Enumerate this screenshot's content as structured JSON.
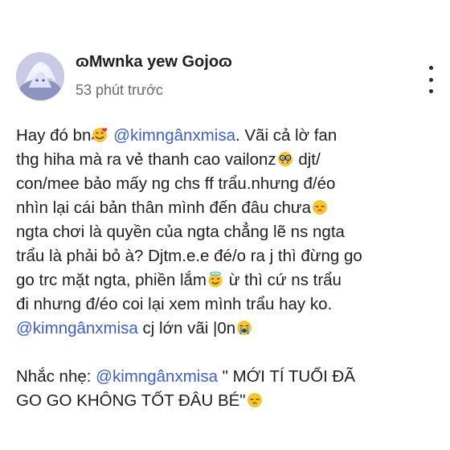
{
  "post": {
    "author": "ɷMwnka yew Gojoɷ",
    "time": "53 phút trước"
  },
  "icons": {
    "more": "more-vertical-icon",
    "avatar": "user-avatar-image"
  },
  "colors": {
    "mention": "#3d5fc7",
    "text": "#1f1f1f",
    "time": "#6b6b6b"
  },
  "content": {
    "l1a": "Hay đó bn",
    "l1b": "@kimngânxmisa",
    "l1c": ". Vãi cả lờ fan",
    "l2a": "thg hiha mà ra vẻ thanh cao vailonz",
    "l2b": " djt/",
    "l3": "con/mee  bảo mấy ng chs ff trẩu.nhưng đ/éo",
    "l4": "nhìn lại cái bản thân mình đến đâu chưa",
    "l5": "ngta chơi là quyền của ngta chẳng lẽ ns ngta",
    "l6": "trẩu là phải bỏ à? Djtm.e.e đé/o ra j thì đừng go",
    "l7a": "go trc mặt ngta, phiền lắm",
    "l7b": " ừ thì cứ ns trẩu",
    "l8": "đi nhưng đ/éo coi lại xem mình trẩu hay ko.",
    "l9a": "@kimngânxmisa",
    "l9b": " cj lớn vãi |0n",
    "l10a": "Nhắc nhẹ: ",
    "l10b": "@kimngânxmisa",
    "l10c": " \" MỚI TÍ TUỔI ĐÃ",
    "l11": "GO GO KHÔNG TỐT ĐÂU BÉ\""
  }
}
